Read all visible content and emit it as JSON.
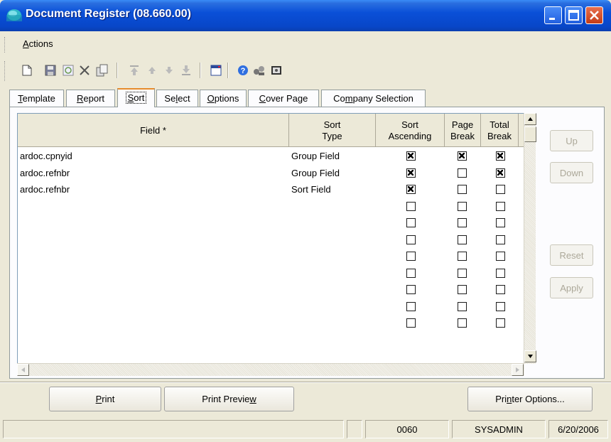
{
  "window": {
    "title": "Document Register (08.660.00)"
  },
  "menu": {
    "actions_accel": "A",
    "actions_rest": "ctions"
  },
  "toolbar": {
    "icons": [
      "new-icon",
      "save-icon",
      "refresh-icon",
      "delete-icon",
      "copy-icon",
      "first-icon",
      "previous-icon",
      "next-icon",
      "last-icon",
      "form-icon",
      "help-icon",
      "customize-icon",
      "notes-icon"
    ]
  },
  "tabs": [
    {
      "pre": "",
      "accel": "T",
      "post": "emplate"
    },
    {
      "pre": "",
      "accel": "R",
      "post": "eport"
    },
    {
      "pre": "",
      "accel": "S",
      "post": "ort"
    },
    {
      "pre": "Se",
      "accel": "l",
      "post": "ect"
    },
    {
      "pre": "",
      "accel": "O",
      "post": "ptions"
    },
    {
      "pre": "",
      "accel": "C",
      "post": "over Page"
    },
    {
      "pre": "Co",
      "accel": "m",
      "post": "pany Selection"
    }
  ],
  "grid": {
    "headers": {
      "field": "Field *",
      "sort_type": "Sort\nType",
      "sort_ascending": "Sort\nAscending",
      "page_break": "Page\nBreak",
      "total_break": "Total\nBreak"
    },
    "rows": [
      {
        "field": "ardoc.cpnyid",
        "sort_type": "Group Field",
        "asc": true,
        "page": true,
        "total": true
      },
      {
        "field": "ardoc.refnbr",
        "sort_type": "Group Field",
        "asc": true,
        "page": false,
        "total": true
      },
      {
        "field": "ardoc.refnbr",
        "sort_type": "Sort Field",
        "asc": true,
        "page": false,
        "total": false
      },
      {
        "field": "",
        "sort_type": "",
        "asc": false,
        "page": false,
        "total": false
      },
      {
        "field": "",
        "sort_type": "",
        "asc": false,
        "page": false,
        "total": false
      },
      {
        "field": "",
        "sort_type": "",
        "asc": false,
        "page": false,
        "total": false
      },
      {
        "field": "",
        "sort_type": "",
        "asc": false,
        "page": false,
        "total": false
      },
      {
        "field": "",
        "sort_type": "",
        "asc": false,
        "page": false,
        "total": false
      },
      {
        "field": "",
        "sort_type": "",
        "asc": false,
        "page": false,
        "total": false
      },
      {
        "field": "",
        "sort_type": "",
        "asc": false,
        "page": false,
        "total": false
      },
      {
        "field": "",
        "sort_type": "",
        "asc": false,
        "page": false,
        "total": false
      }
    ]
  },
  "side_buttons": {
    "up": "Up",
    "down": "Down",
    "reset": "Reset",
    "apply": "Apply"
  },
  "bottom_buttons": {
    "print_accel": "P",
    "print_rest": "rint",
    "preview_pre": "Print Previe",
    "preview_accel": "w",
    "options_pre": "Pri",
    "options_accel": "n",
    "options_post": "ter Options..."
  },
  "status": {
    "panel1": "",
    "panel2": "",
    "code": "0060",
    "user": "SYSADMIN",
    "date": "6/20/2006"
  },
  "colors": {
    "title_blue": "#0a50d8",
    "active_tab_accent": "#e68b2c",
    "window_bg": "#ece9d8"
  }
}
